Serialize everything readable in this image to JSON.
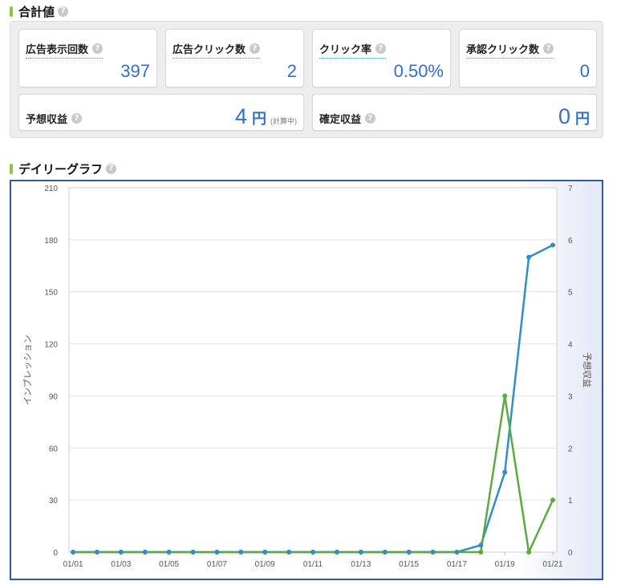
{
  "summary": {
    "title": "合計値",
    "cards": {
      "impressions": {
        "label": "広告表示回数",
        "value": "397"
      },
      "clicks": {
        "label": "広告クリック数",
        "value": "2"
      },
      "ctr": {
        "label": "クリック率",
        "value": "0.50%"
      },
      "approved_clicks": {
        "label": "承認クリック数",
        "value": "0"
      },
      "expected_revenue": {
        "label": "予想収益",
        "value": "4",
        "unit": "円",
        "note": "(計算中)"
      },
      "confirmed_revenue": {
        "label": "確定収益",
        "value": "0",
        "unit": "円"
      }
    }
  },
  "daily": {
    "title": "デイリーグラフ"
  },
  "help_icon": "question-mark-icon",
  "colors": {
    "accent_bar": "#8cc63f",
    "value_text": "#2f6fd0",
    "frame": "#2f5aa5",
    "impressions_line": "#2e8fc9",
    "revenue_line": "#5aab3c"
  },
  "chart_data": {
    "type": "line",
    "x": [
      "01/01",
      "01/02",
      "01/03",
      "01/04",
      "01/05",
      "01/06",
      "01/07",
      "01/08",
      "01/09",
      "01/10",
      "01/11",
      "01/12",
      "01/13",
      "01/14",
      "01/15",
      "01/16",
      "01/17",
      "01/18",
      "01/19",
      "01/20",
      "01/21"
    ],
    "x_tick_labels": [
      "01/01",
      "01/03",
      "01/05",
      "01/07",
      "01/09",
      "01/11",
      "01/13",
      "01/15",
      "01/17",
      "01/19",
      "01/21"
    ],
    "ylabel": "インプレッション",
    "y2label": "予想収益",
    "ylim": [
      0,
      210
    ],
    "y_ticks": [
      0,
      30,
      60,
      90,
      120,
      150,
      180,
      210
    ],
    "y2lim": [
      0,
      7
    ],
    "y2_ticks": [
      0,
      1,
      2,
      3,
      4,
      5,
      6,
      7
    ],
    "grid": true,
    "series": [
      {
        "axis": "left",
        "color": "#2e8fc9",
        "values": [
          0,
          0,
          0,
          0,
          0,
          0,
          0,
          0,
          0,
          0,
          0,
          0,
          0,
          0,
          0,
          0,
          0,
          4,
          46,
          170,
          177
        ]
      },
      {
        "axis": "right",
        "color": "#5aab3c",
        "values": [
          0,
          0,
          0,
          0,
          0,
          0,
          0,
          0,
          0,
          0,
          0,
          0,
          0,
          0,
          0,
          0,
          0,
          0,
          3,
          0,
          1
        ]
      }
    ]
  }
}
